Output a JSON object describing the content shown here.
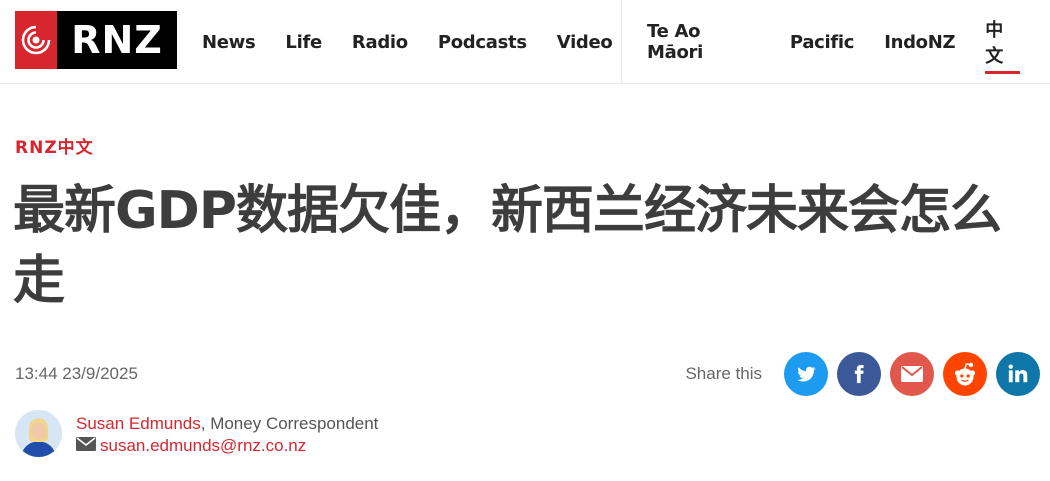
{
  "logo": {
    "text": "RNZ"
  },
  "nav": {
    "main": [
      "News",
      "Life",
      "Radio",
      "Podcasts",
      "Video"
    ],
    "languages": [
      "Te Ao Māori",
      "Pacific",
      "IndoNZ",
      "中文"
    ],
    "active_language": "中文"
  },
  "article": {
    "section": "RNZ中文",
    "headline": "最新GDP数据欠佳，新西兰经济未来会怎么走",
    "timestamp": "13:44 23/9/2025"
  },
  "share": {
    "label": "Share this",
    "buttons": [
      {
        "name": "twitter",
        "color": "#1d9bf0"
      },
      {
        "name": "facebook",
        "color": "#3b5998"
      },
      {
        "name": "email",
        "color": "#e2574c"
      },
      {
        "name": "reddit",
        "color": "#ff4500"
      },
      {
        "name": "linkedin",
        "color": "#0e76a8"
      }
    ]
  },
  "author": {
    "name": "Susan Edmunds",
    "role": ", Money Correspondent",
    "email": "susan.edmunds@rnz.co.nz"
  },
  "colors": {
    "brand_red": "#d8262f",
    "text_dark": "#3d3d3d"
  }
}
